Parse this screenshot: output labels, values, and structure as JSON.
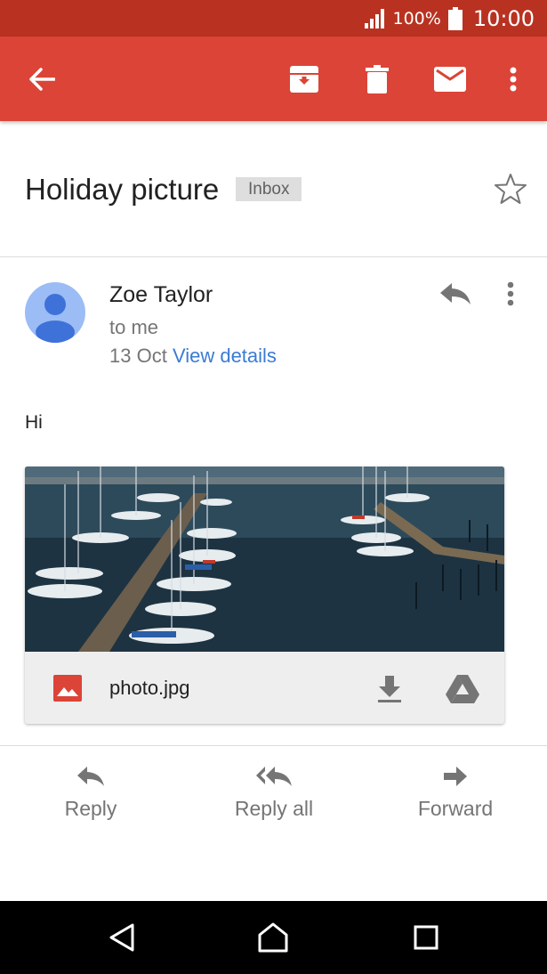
{
  "status_bar": {
    "battery": "100%",
    "time": "10:00"
  },
  "app_bar": {
    "icons": [
      "arrow-back-icon",
      "archive-icon",
      "delete-icon",
      "mark-unread-icon",
      "more-vert-icon"
    ],
    "color": "#db4437"
  },
  "email": {
    "subject": "Holiday picture",
    "label": "Inbox",
    "sender": "Zoe Taylor",
    "recipient": "to me",
    "date": "13 Oct",
    "view_details": "View details",
    "body": "Hi",
    "attachment": {
      "file_name": "photo.jpg"
    }
  },
  "actions": {
    "reply": "Reply",
    "reply_all": "Reply all",
    "forward": "Forward"
  },
  "colors": {
    "status_bar": "#b93221",
    "accent": "#db4437",
    "link": "#3b7bd4"
  }
}
